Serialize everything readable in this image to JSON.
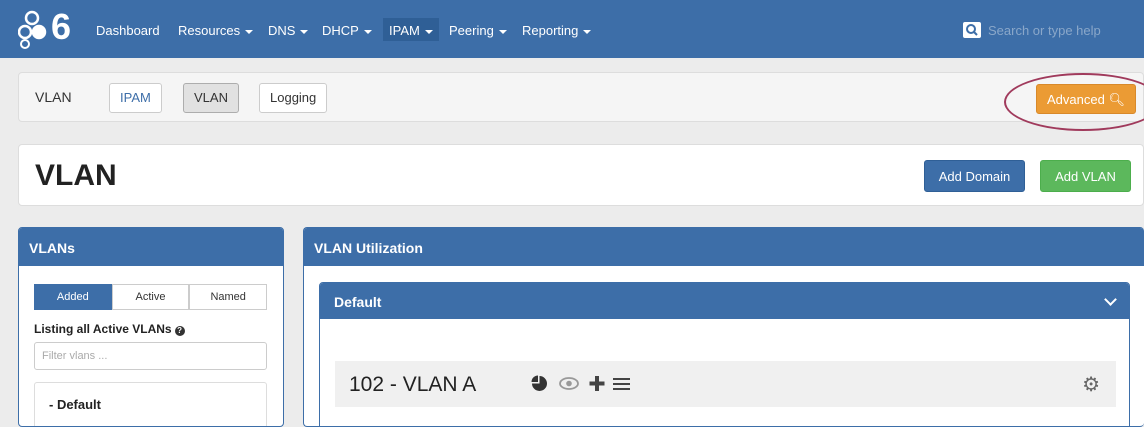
{
  "navbar": {
    "logo_text": "6",
    "items": [
      {
        "label": "Dashboard",
        "caret": false
      },
      {
        "label": "Resources",
        "caret": true
      },
      {
        "label": "DNS",
        "caret": true
      },
      {
        "label": "DHCP",
        "caret": true
      },
      {
        "label": "IPAM",
        "caret": true
      },
      {
        "label": "Peering",
        "caret": true
      },
      {
        "label": "Reporting",
        "caret": true
      }
    ],
    "search_placeholder": "Search or type help"
  },
  "subnav": {
    "title": "VLAN",
    "tabs": [
      "IPAM",
      "VLAN",
      "Logging"
    ],
    "advanced_label": "Advanced"
  },
  "header": {
    "title": "VLAN",
    "add_domain_label": "Add Domain",
    "add_vlan_label": "Add VLAN"
  },
  "vlans_panel": {
    "title": "VLANs",
    "filters": [
      "Added",
      "Active",
      "Named"
    ],
    "listing_text": "Listing all Active VLANs",
    "filter_placeholder": "Filter vlans ...",
    "list_items": [
      "- Default"
    ]
  },
  "utilization_panel": {
    "title": "VLAN Utilization",
    "domain_title": "Default",
    "vlan_row": {
      "label": "102 - VLAN A"
    }
  },
  "colors": {
    "navbar": "#3d6ea8",
    "advanced": "#eb9b34",
    "add_vlan": "#5cb85c",
    "highlight": "#a03a5c"
  }
}
